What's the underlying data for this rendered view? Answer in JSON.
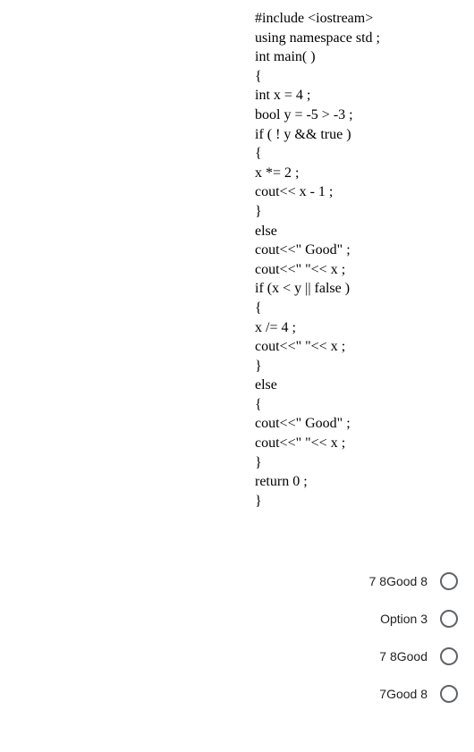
{
  "code": {
    "lines": [
      "#include <iostream>",
      "using namespace std ;",
      "int main( )",
      "{",
      "int x = 4 ;",
      "bool y = -5 > -3 ;",
      "if ( ! y && true )",
      "{",
      "x *= 2 ;",
      "cout<< x - 1 ;",
      "}",
      "else",
      "cout<<\" Good\" ;",
      "cout<<\" \"<< x ;",
      "if (x < y || false )",
      "{",
      "x /= 4 ;",
      "cout<<\" \"<< x ;",
      "}",
      "else",
      "{",
      "cout<<\" Good\" ;",
      "cout<<\" \"<< x ;",
      "}",
      "return 0 ;",
      "}"
    ]
  },
  "options": [
    {
      "label": "7 8Good 8"
    },
    {
      "label": "Option 3"
    },
    {
      "label": "7 8Good"
    },
    {
      "label": "7Good 8"
    }
  ]
}
